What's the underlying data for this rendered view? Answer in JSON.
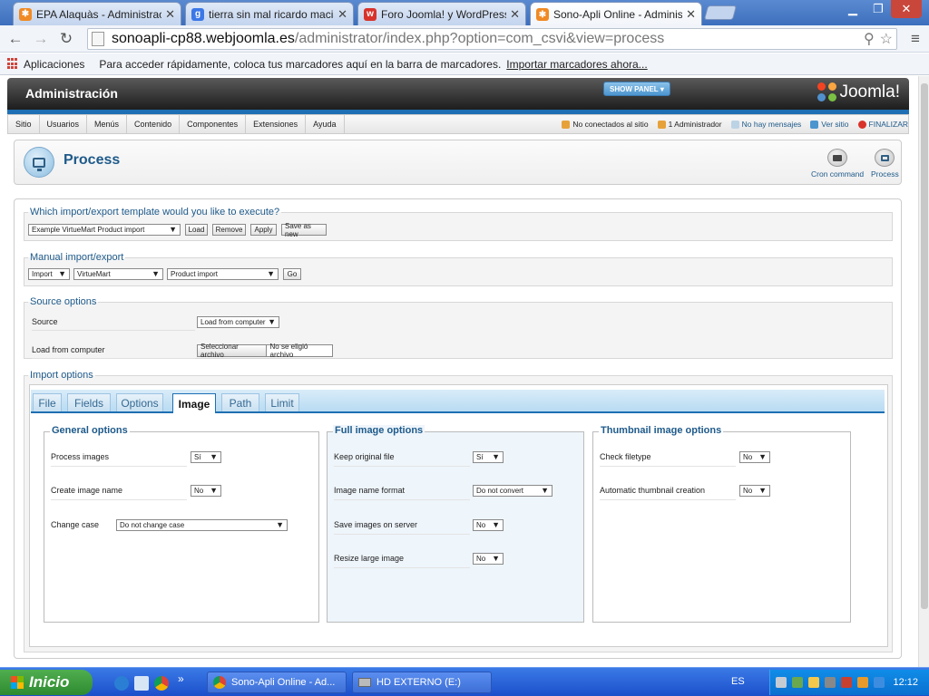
{
  "browser": {
    "tabs": [
      {
        "title": "EPA Alaquàs - Administración",
        "icon": "joomla-icon"
      },
      {
        "title": "tierra sin mal ricardo macian",
        "icon": "google-icon"
      },
      {
        "title": "Foro Joomla! y WordPress :: ",
        "icon": "forum-icon"
      },
      {
        "title": "Sono-Apli Online - Administra",
        "icon": "joomla-icon"
      }
    ],
    "url_host": "sonoapli-cp88.webjoomla.es",
    "url_path": "/administrator/index.php?option=com_csvi&view=process",
    "bookmarks": {
      "apps_label": "Aplicaciones",
      "hint": "Para acceder rápidamente, coloca tus marcadores aquí en la barra de marcadores.",
      "import_link": "Importar marcadores ahora..."
    }
  },
  "joomla": {
    "admin_title": "Administración",
    "show_panel": "SHOW PANEL",
    "logo_text": "Joomla!",
    "menu": [
      "Sitio",
      "Usuarios",
      "Menús",
      "Contenido",
      "Componentes",
      "Extensiones",
      "Ayuda"
    ],
    "status": {
      "visitors": "No conectados al sitio",
      "admins": "1 Administrador",
      "messages": "No hay mensajes",
      "view_site": "Ver sitio",
      "logout": "FINALIZAR"
    },
    "page_title": "Process",
    "toolbar": {
      "cron": "Cron command",
      "process": "Process"
    }
  },
  "form": {
    "template": {
      "legend": "Which import/export template would you like to execute?",
      "select_value": "Example VirtueMart Product import",
      "buttons": [
        "Load",
        "Remove",
        "Apply",
        "Save as new"
      ]
    },
    "manual": {
      "legend": "Manual import/export",
      "action": "Import",
      "component": "VirtueMart",
      "operation": "Product import",
      "go": "Go"
    },
    "source": {
      "legend": "Source options",
      "source_label": "Source",
      "source_value": "Load from computer",
      "file_label": "Load from computer",
      "file_button": "Seleccionar archivo",
      "file_status": "No se eligió archivo"
    },
    "import": {
      "legend": "Import options",
      "tabs": [
        "File",
        "Fields",
        "Options",
        "Image",
        "Path",
        "Limit"
      ],
      "active_tab": "Image",
      "general": {
        "title": "General options",
        "process_images": {
          "label": "Process images",
          "value": "Sí"
        },
        "create_image_name": {
          "label": "Create image name",
          "value": "No"
        },
        "change_case": {
          "label": "Change case",
          "value": "Do not change case"
        }
      },
      "full": {
        "title": "Full image options",
        "keep_original": {
          "label": "Keep original file",
          "value": "Sí"
        },
        "name_format": {
          "label": "Image name format",
          "value": "Do not convert"
        },
        "save_on_server": {
          "label": "Save images on server",
          "value": "No"
        },
        "resize_large": {
          "label": "Resize large image",
          "value": "No"
        }
      },
      "thumb": {
        "title": "Thumbnail image options",
        "check_filetype": {
          "label": "Check filetype",
          "value": "No"
        },
        "auto_thumb": {
          "label": "Automatic thumbnail creation",
          "value": "No"
        }
      }
    }
  },
  "taskbar": {
    "start": "Inicio",
    "items": [
      "Sono-Apli Online - Ad...",
      "HD EXTERNO (E:)"
    ],
    "language": "ES",
    "clock": "12:12"
  }
}
